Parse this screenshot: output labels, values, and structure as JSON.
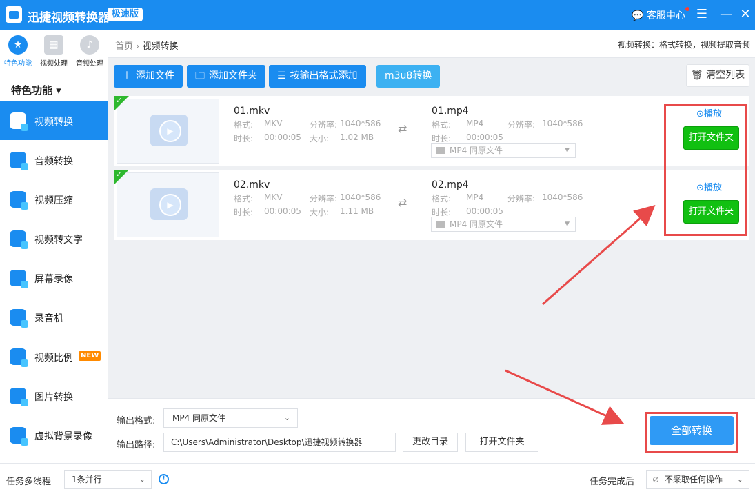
{
  "app": {
    "title": "迅捷视频转换器",
    "edition": "极速版",
    "service_label": "客服中心",
    "menu_icon": "☰",
    "min_icon": "—",
    "close_icon": "✕"
  },
  "categories": [
    {
      "label": "特色功能",
      "icon": "star-icon",
      "glyph": "★"
    },
    {
      "label": "视频处理",
      "icon": "film-icon",
      "glyph": "▦"
    },
    {
      "label": "音频处理",
      "icon": "music-icon",
      "glyph": "♪"
    }
  ],
  "sidebar": {
    "section_label": "特色功能 ▾",
    "items": [
      {
        "label": "视频转换"
      },
      {
        "label": "音频转换"
      },
      {
        "label": "视频压缩"
      },
      {
        "label": "视频转文字"
      },
      {
        "label": "屏幕录像"
      },
      {
        "label": "录音机"
      },
      {
        "label": "视频比例",
        "badge": "NEW"
      },
      {
        "label": "图片转换"
      },
      {
        "label": "虚拟背景录像"
      }
    ]
  },
  "breadcrumb": {
    "home": "首页",
    "sep": "›",
    "current": "视频转换"
  },
  "header_hint": "视频转换：格式转换，视频提取音频",
  "toolbar": {
    "add_file": "添加文件",
    "add_folder": "添加文件夹",
    "add_by_format": "按输出格式添加",
    "m3u8": "m3u8转换",
    "clear": "清空列表"
  },
  "file_labels": {
    "format": "格式:",
    "resolution": "分辨率:",
    "duration": "时长:",
    "size": "大小:",
    "play": "播放",
    "open_folder": "打开文件夹"
  },
  "files": [
    {
      "src_name": "01.mkv",
      "src_format": "MKV",
      "src_resolution": "1040*586",
      "src_duration": "00:00:05",
      "src_size": "1.02 MB",
      "dst_name": "01.mp4",
      "dst_format": "MP4",
      "dst_resolution": "1040*586",
      "dst_duration": "00:00:05",
      "dst_preset": "MP4  同原文件"
    },
    {
      "src_name": "02.mkv",
      "src_format": "MKV",
      "src_resolution": "1040*586",
      "src_duration": "00:00:05",
      "src_size": "1.11 MB",
      "dst_name": "02.mp4",
      "dst_format": "MP4",
      "dst_resolution": "1040*586",
      "dst_duration": "00:00:05",
      "dst_preset": "MP4  同原文件"
    }
  ],
  "output": {
    "format_label": "输出格式:",
    "format_value": "MP4  同原文件",
    "path_label": "输出路径:",
    "path_value": "C:\\Users\\Administrator\\Desktop\\迅捷视频转换器",
    "change_dir": "更改目录",
    "open_folder": "打开文件夹",
    "convert_all": "全部转换"
  },
  "status": {
    "multithread_label": "任务多线程",
    "multithread_value": "1条并行",
    "after_label": "任务完成后",
    "after_value": "不采取任何操作"
  },
  "colors": {
    "accent": "#1a8cf0",
    "success": "#11c011",
    "annotation": "#e84a4a"
  }
}
